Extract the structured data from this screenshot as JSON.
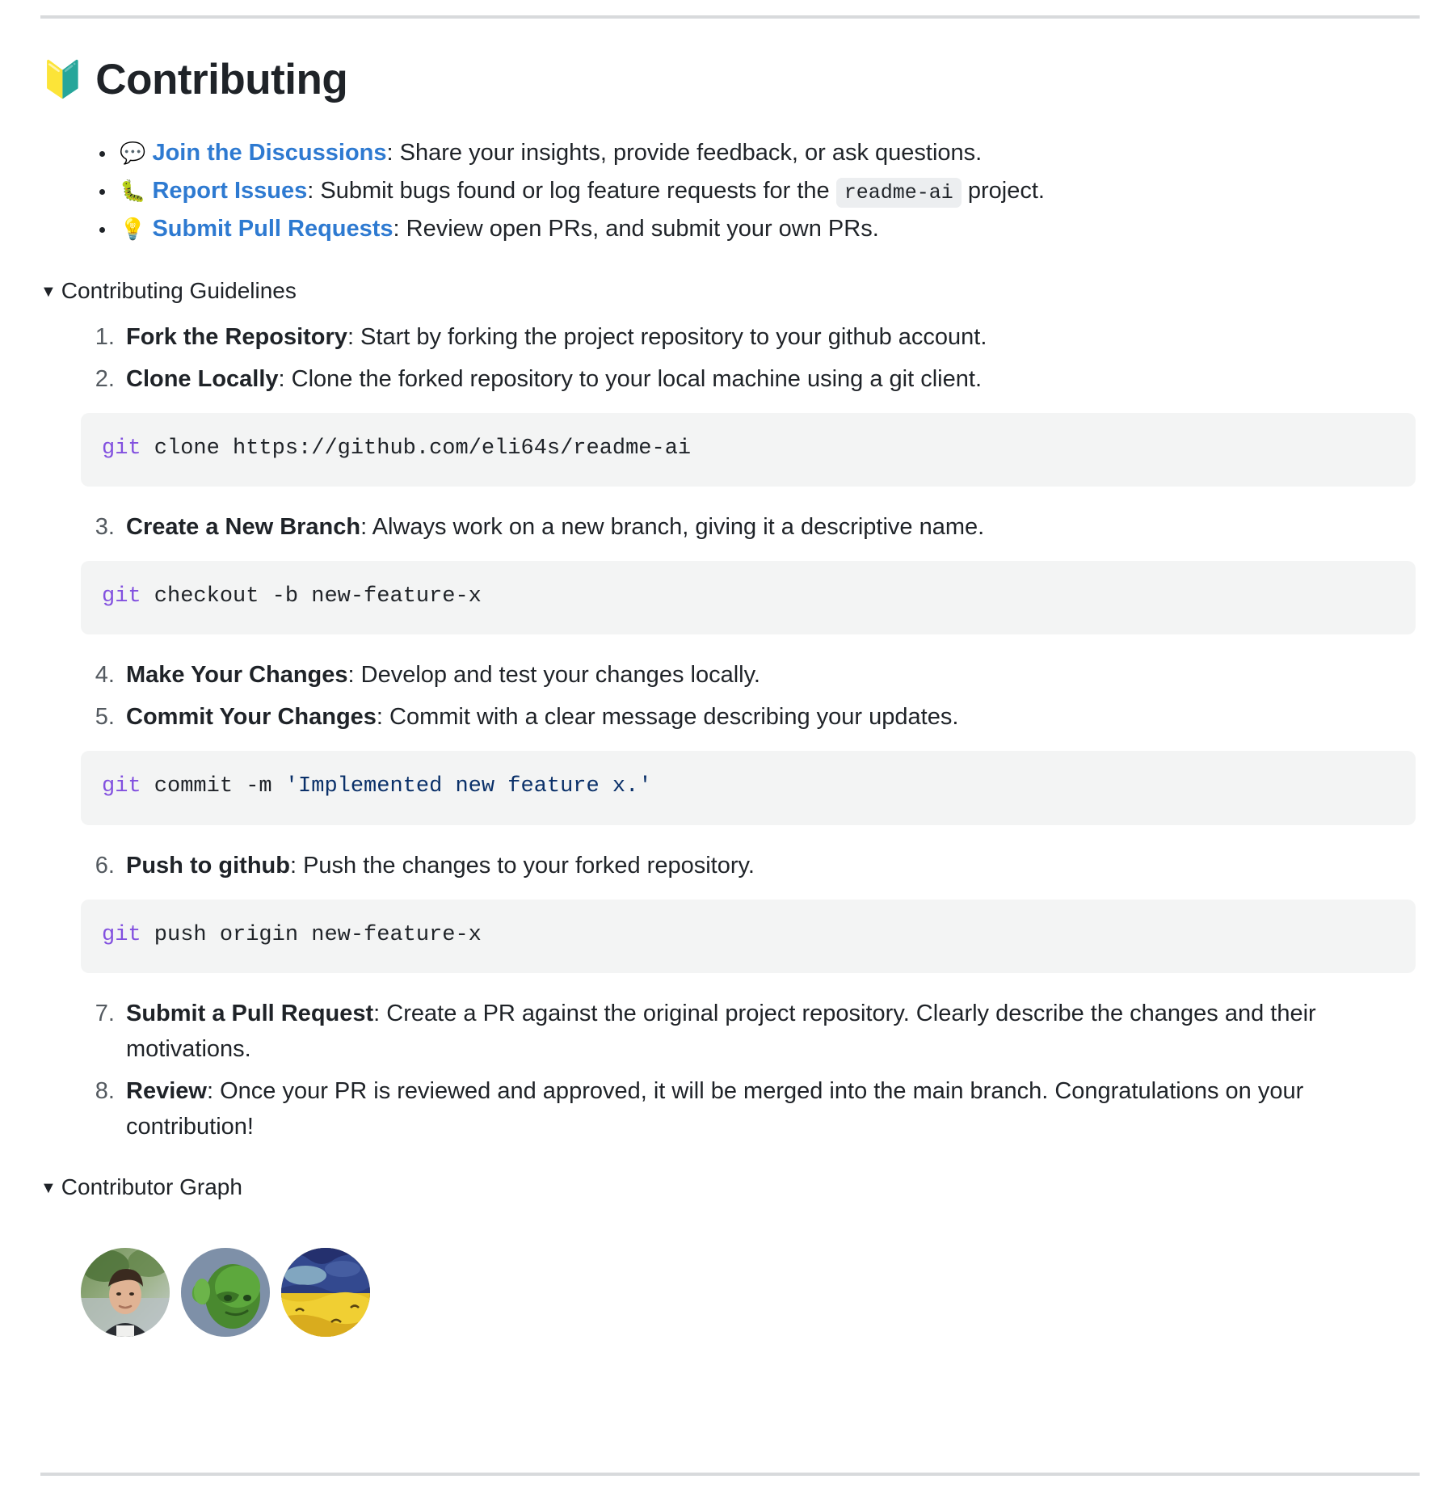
{
  "heading": {
    "emoji": "🔰",
    "emoji_name": "beginner-shield-emoji",
    "text": "Contributing"
  },
  "bullets": [
    {
      "emoji": "💬",
      "emoji_name": "speech-balloon-emoji",
      "link": "Join the Discussions",
      "rest": ": Share your insights, provide feedback, or ask questions."
    },
    {
      "emoji": "🐛",
      "emoji_name": "bug-emoji",
      "link": "Report Issues",
      "rest_before": ": Submit bugs found or log feature requests for the",
      "code": "readme-ai",
      "rest_after": "project."
    },
    {
      "emoji": "💡",
      "emoji_name": "light-bulb-emoji",
      "link": "Submit Pull Requests",
      "rest": ": Review open PRs, and submit your own PRs."
    }
  ],
  "guidelines": {
    "marker": "▼",
    "summary": "Contributing Guidelines",
    "steps": [
      {
        "title": "Fork the Repository",
        "body": ": Start by forking the project repository to your github account."
      },
      {
        "title": "Clone Locally",
        "body": ": Clone the forked repository to your local machine using a git client.",
        "code": {
          "kw": "git",
          "rest": " clone https://github.com/eli64s/readme-ai"
        }
      },
      {
        "title": "Create a New Branch",
        "body": ": Always work on a new branch, giving it a descriptive name.",
        "code": {
          "kw": "git",
          "rest": " checkout -b new-feature-x"
        }
      },
      {
        "title": "Make Your Changes",
        "body": ": Develop and test your changes locally."
      },
      {
        "title": "Commit Your Changes",
        "body": ": Commit with a clear message describing your updates.",
        "code": {
          "kw": "git",
          "rest": " commit -m ",
          "str": "'Implemented new feature x.'"
        }
      },
      {
        "title": "Push to github",
        "body": ": Push the changes to your forked repository.",
        "code": {
          "kw": "git",
          "rest": " push origin new-feature-x"
        }
      },
      {
        "title": "Submit a Pull Request",
        "body": ": Create a PR against the original project repository. Clearly describe the changes and their motivations."
      },
      {
        "title": "Review",
        "body": ": Once your PR is reviewed and approved, it will be merged into the main branch. Congratulations on your contribution!"
      }
    ]
  },
  "contributor_graph": {
    "marker": "▼",
    "summary": "Contributor Graph",
    "avatars": [
      {
        "name": "contributor-avatar-1",
        "alt": "photo of a person in front of greenery"
      },
      {
        "name": "contributor-avatar-2",
        "alt": "green goblin character on blue-grey background"
      },
      {
        "name": "contributor-avatar-3",
        "alt": "van gogh style yellow wheatfield under blue sky"
      }
    ]
  },
  "colors": {
    "link": "#2e7ad1",
    "code_bg": "#f3f4f4",
    "inline_code_bg": "#eceef0",
    "keyword": "#8250df",
    "string": "#0a3069",
    "rule": "#d8dadc",
    "text": "#1f2328"
  }
}
